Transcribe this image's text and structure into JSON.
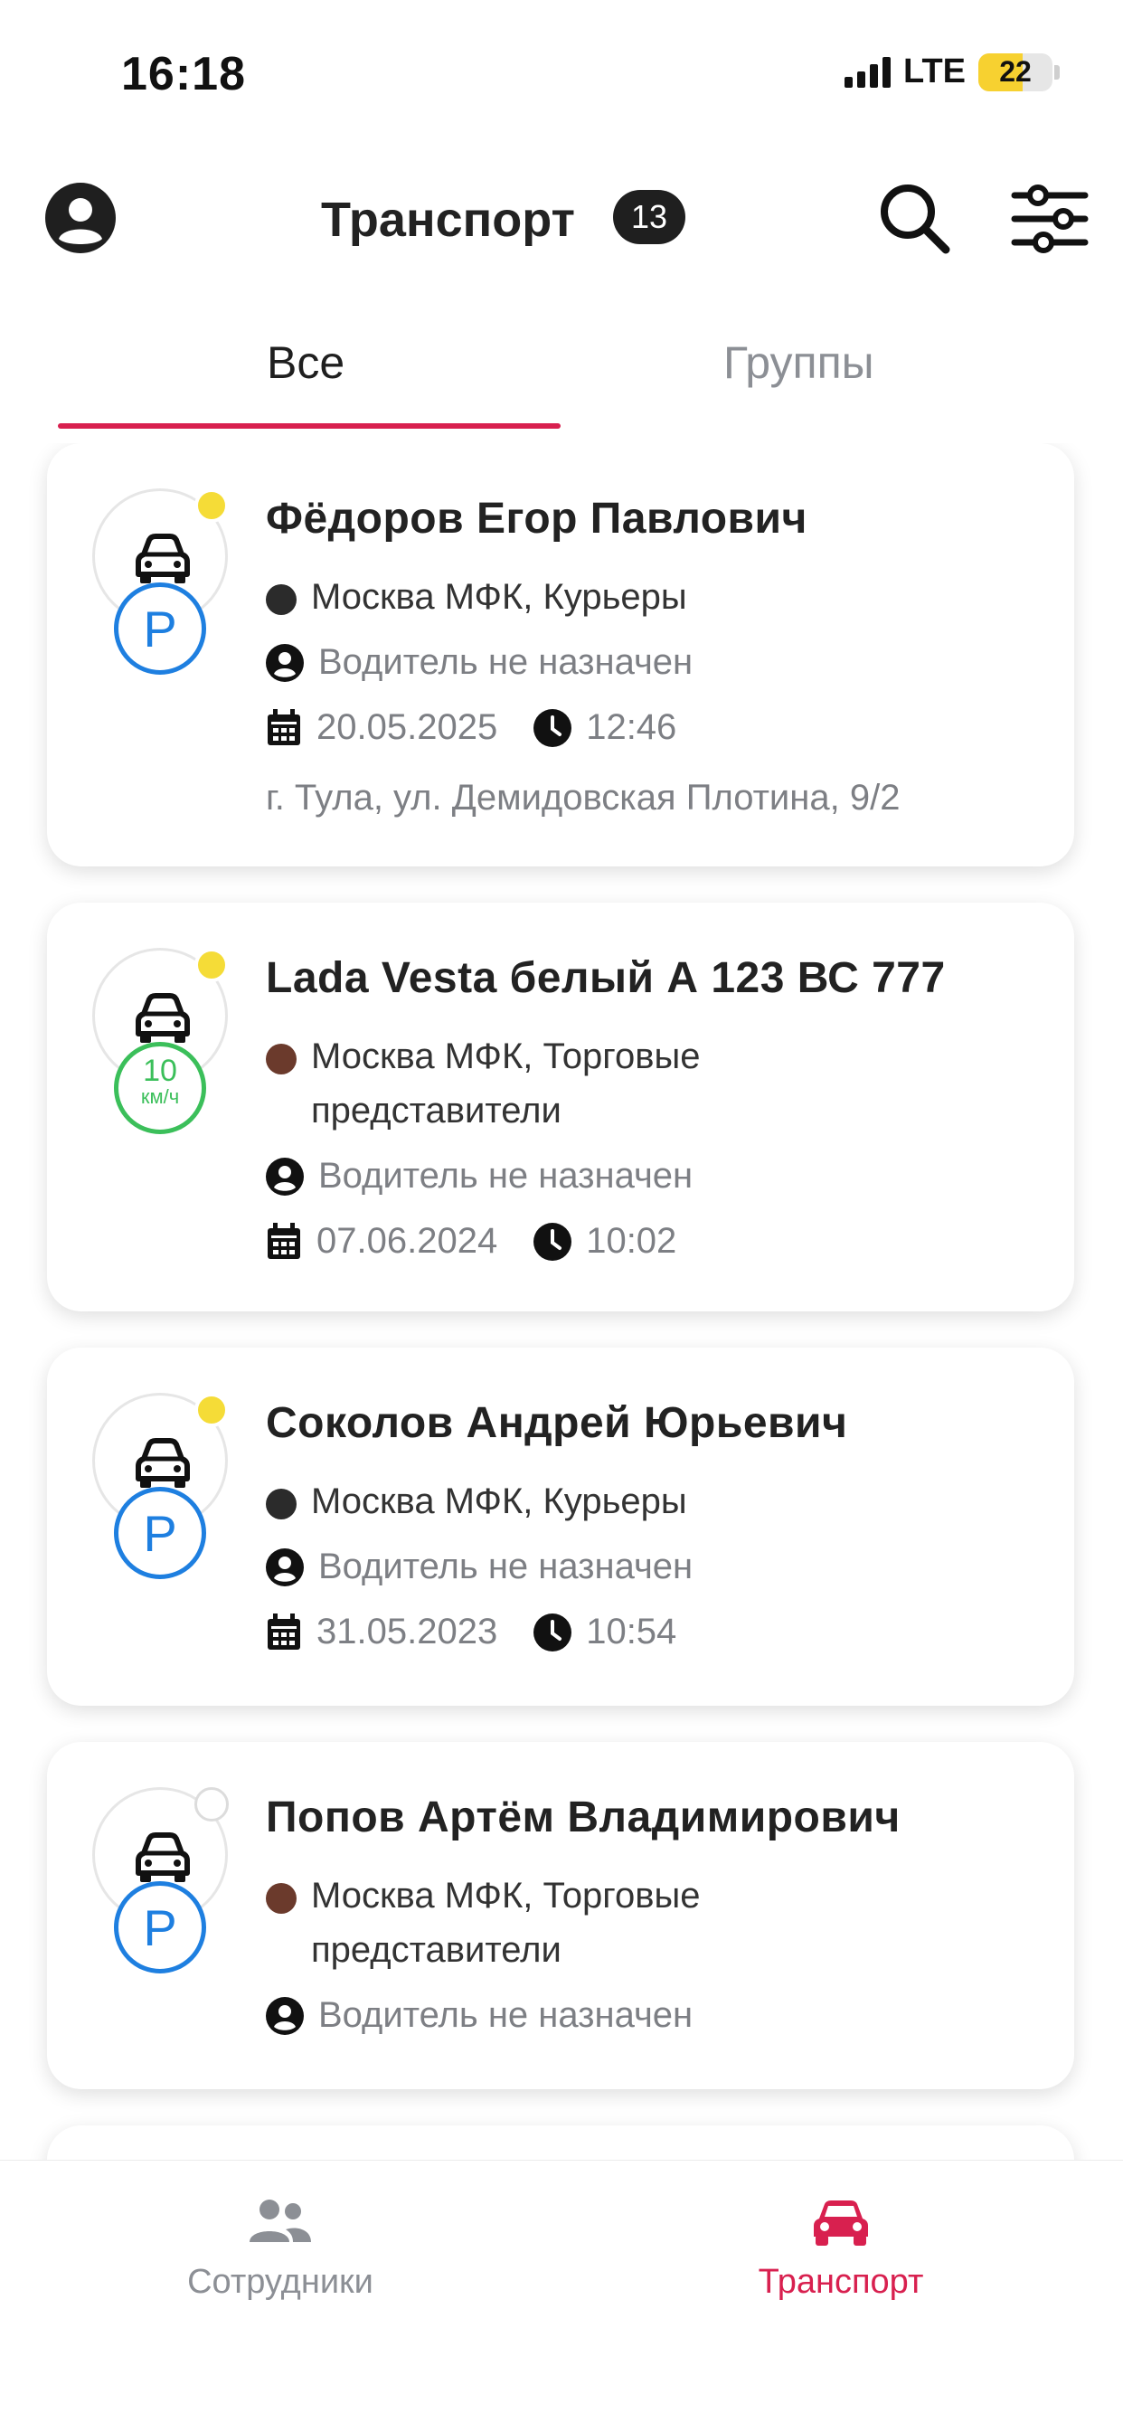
{
  "status_bar": {
    "time": "16:18",
    "network": "LTE",
    "battery": "22",
    "battery_color": "#f7d130"
  },
  "header": {
    "title": "Транспорт",
    "count": "13"
  },
  "tabs": [
    {
      "label": "Все",
      "active": true
    },
    {
      "label": "Группы",
      "active": false
    }
  ],
  "colors": {
    "accent": "#d8204f",
    "parking": "#1e7fe0",
    "speed": "#3bbf5a",
    "status_yellow": "#f5dc37"
  },
  "cards": [
    {
      "title": "Фёдоров Егор Павлович",
      "group": "Москва МФК, Курьеры",
      "group_dot_color": "#2b2b2b",
      "driver": "Водитель не назначен",
      "date": "20.05.2025",
      "time": "12:46",
      "address": "г. Тула, ул. Демидовская Плотина, 9/2",
      "badge": "P",
      "status_color": "#f5dc37"
    },
    {
      "title": "Lada Vesta белый А 123 ВС 777",
      "group_line1": "Москва МФК, Торговые",
      "group_line2": "представители",
      "group_dot_color": "#6b3a2c",
      "driver": "Водитель не назначен",
      "date": "07.06.2024",
      "time": "10:02",
      "speed": "10",
      "speed_unit": "км/ч",
      "status_color": "#f5dc37"
    },
    {
      "title": "Соколов Андрей Юрьевич",
      "group": "Москва МФК, Курьеры",
      "group_dot_color": "#2b2b2b",
      "driver": "Водитель не назначен",
      "date": "31.05.2023",
      "time": "10:54",
      "badge": "P",
      "status_color": "#f5dc37"
    },
    {
      "title": "Попов Артём Владимирович",
      "group_line1": "Москва МФК, Торговые",
      "group_line2": "представители",
      "group_dot_color": "#6b3a2c",
      "driver": "Водитель не назначен",
      "badge": "P",
      "status_color": "#ffffff"
    }
  ],
  "bottom_nav": [
    {
      "label": "Сотрудники",
      "icon": "people-icon",
      "active": false
    },
    {
      "label": "Транспорт",
      "icon": "car-icon",
      "active": true
    }
  ]
}
